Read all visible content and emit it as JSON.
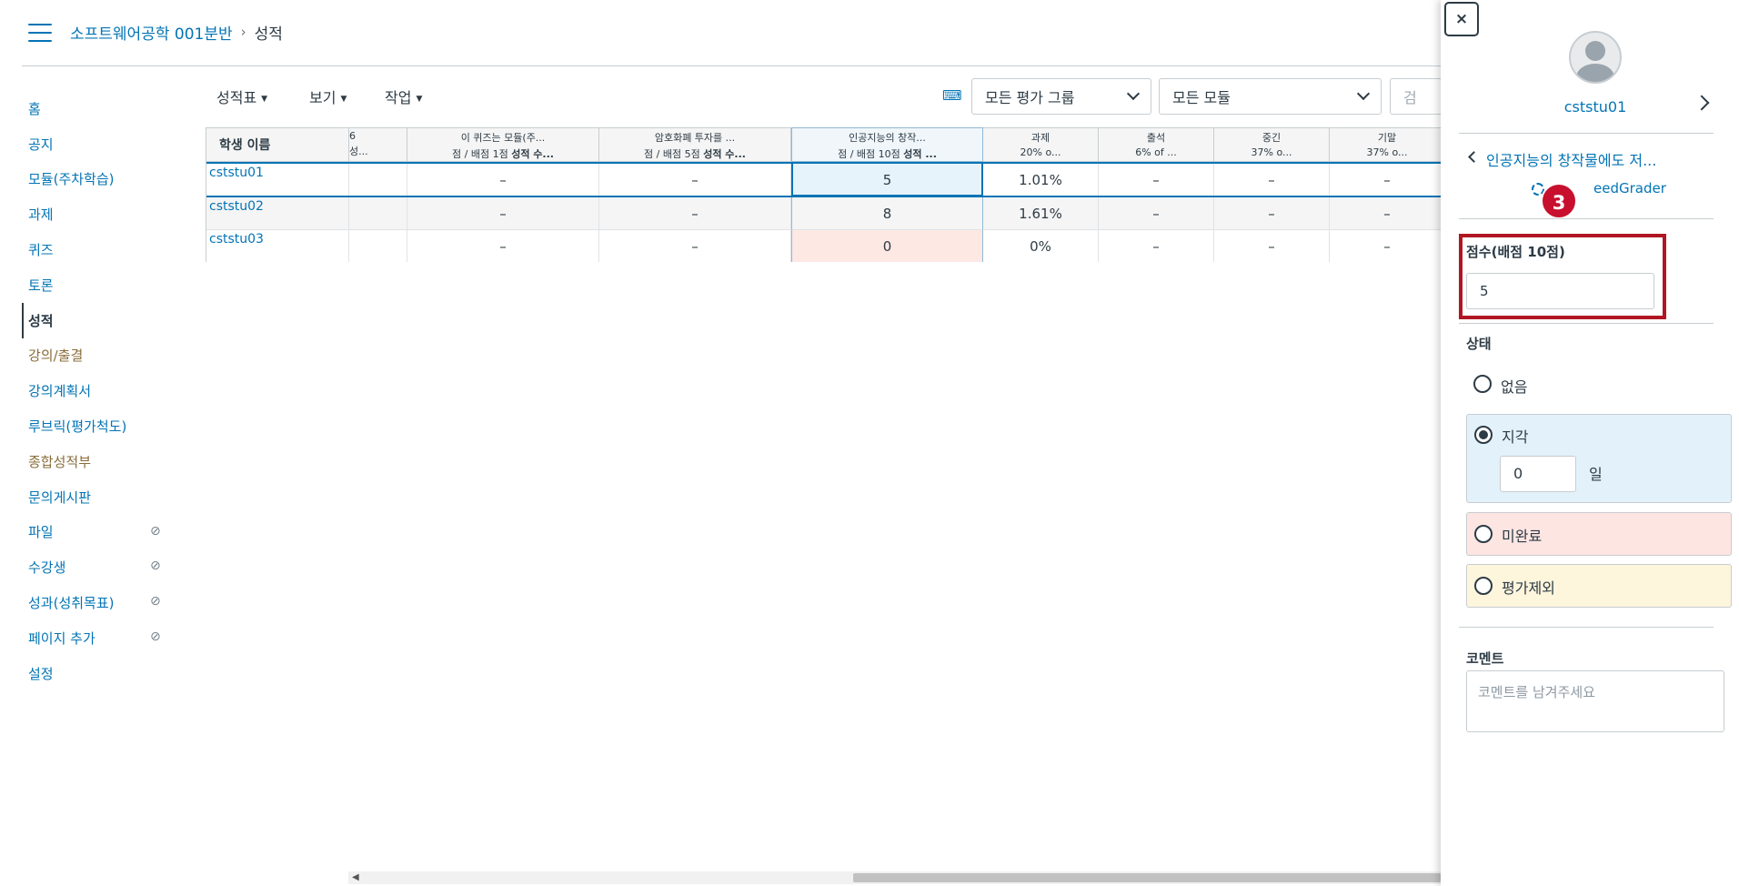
{
  "header": {
    "course": "소프트웨어공학 001분반",
    "separator": "›",
    "current": "성적"
  },
  "sidebar": {
    "items": [
      {
        "label": "홈"
      },
      {
        "label": "공지"
      },
      {
        "label": "모듈(주차학습)"
      },
      {
        "label": "과제"
      },
      {
        "label": "퀴즈"
      },
      {
        "label": "토론"
      },
      {
        "label": "성적"
      },
      {
        "label": "강의/출결"
      },
      {
        "label": "강의계획서"
      },
      {
        "label": "루브릭(평가척도)"
      },
      {
        "label": "종합성적부"
      },
      {
        "label": "문의게시판"
      },
      {
        "label": "파일"
      },
      {
        "label": "수강생"
      },
      {
        "label": "성과(성취목표)"
      },
      {
        "label": "페이지 추가"
      },
      {
        "label": "설정"
      }
    ],
    "hidden_icon": "eye-off-icon"
  },
  "toolbar": {
    "gradebook_menu": "성적표",
    "view_menu": "보기",
    "actions_menu": "작업",
    "keyboard_icon": "keyboard-icon",
    "group_select": "모든 평가 그룹",
    "module_select": "모든 모듈",
    "search_partial": "검"
  },
  "grid": {
    "student_header": "학생 이름",
    "columns": [
      {
        "line1": "6",
        "line2": "성..."
      },
      {
        "line1": "이 퀴즈는 모듈(주...",
        "line2_prefix": "점 / 배점 1점 ",
        "line2_bold": "성적 수..."
      },
      {
        "line1": "암호화폐 투자를 ...",
        "line2_prefix": "점 / 배점 5점 ",
        "line2_bold": "성적 수..."
      },
      {
        "line1": "인공지능의 창작...",
        "line2_prefix": "점 / 배점 10점 ",
        "line2_bold": "성적 ..."
      },
      {
        "line1": "과제",
        "line2": "20% o..."
      },
      {
        "line1": "출석",
        "line2": "6% of ..."
      },
      {
        "line1": "중긴",
        "line2": "37% o..."
      },
      {
        "line1": "기말",
        "line2": "37% o..."
      }
    ],
    "rows": [
      {
        "student": "cststu01",
        "cells": [
          "",
          "–",
          "–",
          "5",
          "1.01%",
          "–",
          "–",
          "–"
        ]
      },
      {
        "student": "cststu02",
        "cells": [
          "",
          "–",
          "–",
          "8",
          "1.61%",
          "–",
          "–",
          "–"
        ]
      },
      {
        "student": "cststu03",
        "cells": [
          "",
          "–",
          "–",
          "0",
          "0%",
          "–",
          "–",
          "–"
        ]
      }
    ]
  },
  "tray": {
    "close": "×",
    "student_name": "cststu01",
    "assignment_link": "인공지능의 창작물에도 저...",
    "speedgrader_link": "eedGrader",
    "badge": "3",
    "score_label": "점수(배점 10점)",
    "score_value": "5",
    "status_label": "상태",
    "status_options": [
      "없음",
      "지각",
      "미완료",
      "평가제외"
    ],
    "late_days_value": "0",
    "late_days_unit": "일",
    "comment_label": "코멘트",
    "comment_placeholder": "코멘트를 남겨주세요"
  },
  "colors": {
    "link": "#0374b5",
    "text": "#2d3b45",
    "highlight_box": "#b11623",
    "badge": "#c8102e",
    "late_bg": "#e3f1fb",
    "missing_bg": "#fde5e2",
    "excused_bg": "#fdf5dc"
  }
}
